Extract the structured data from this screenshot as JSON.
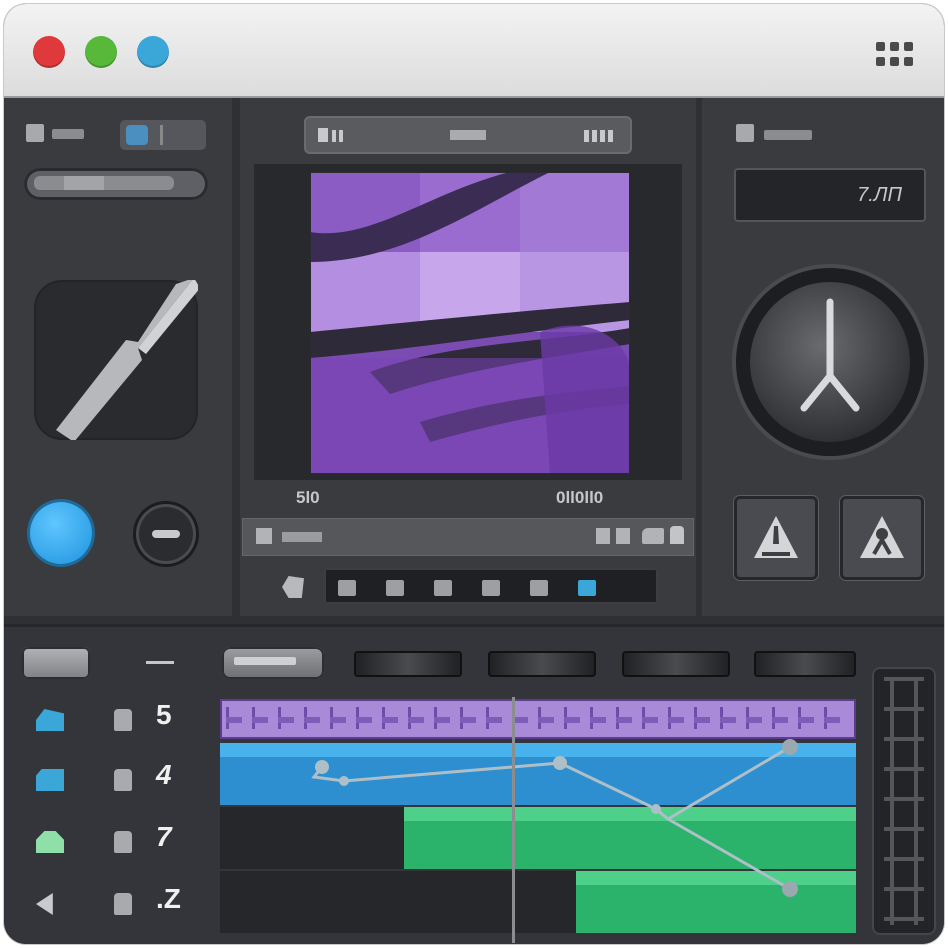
{
  "window": {
    "traffic_lights": [
      "#e0393b",
      "#58b83a",
      "#3aa7d8"
    ],
    "menu_icon": "grid-menu-icon"
  },
  "preview": {
    "left_caption": "5l0",
    "right_caption": "0ll0ll0"
  },
  "inspector": {
    "display_value": "7.ЛП"
  },
  "tracks": [
    {
      "icon": "shape-icon",
      "number": "5",
      "color": "#3aa7d8"
    },
    {
      "icon": "clip-icon",
      "number": "4",
      "color": "#3aa7d8"
    },
    {
      "icon": "cloud-icon",
      "number": "7",
      "color": "#8fe0a8"
    },
    {
      "icon": "speaker-icon",
      "number": ".Z",
      "color": "#c9cacd"
    }
  ],
  "colors": {
    "accent_blue": "#3aa7d8",
    "clip_purple": "#a98ad8",
    "clip_blue": "#2d8fd0",
    "clip_green": "#2bb36b"
  }
}
